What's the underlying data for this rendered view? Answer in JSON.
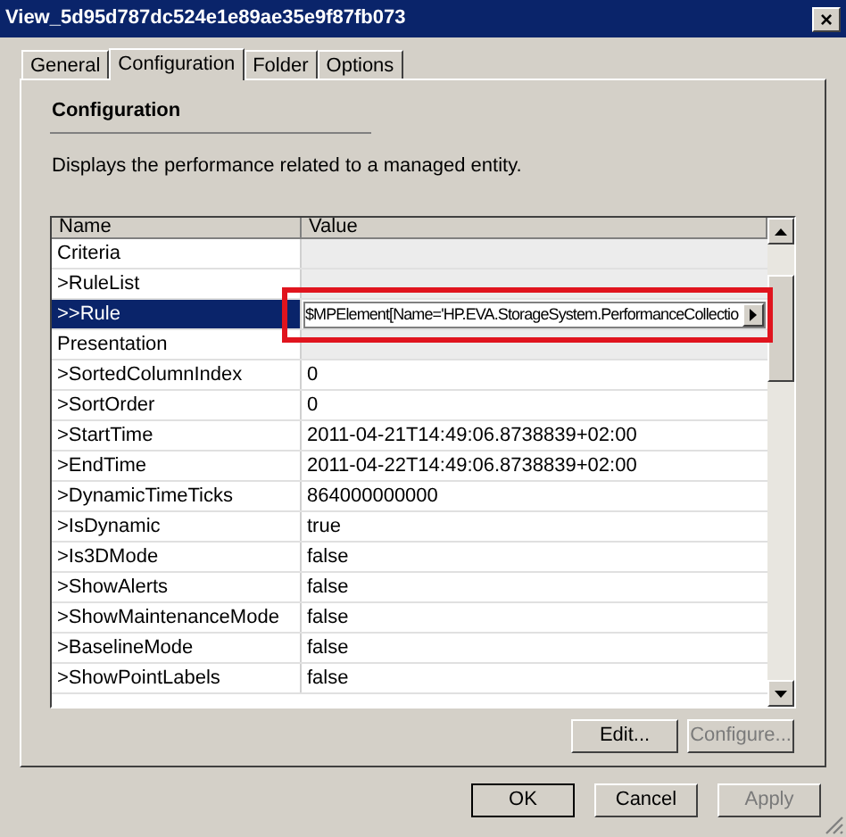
{
  "window": {
    "title": "View_5d95d787dc524e1e89ae35e9f87fb073",
    "close": "×"
  },
  "tabs": [
    {
      "label": "General",
      "selected": false
    },
    {
      "label": "Configuration",
      "selected": true
    },
    {
      "label": "Folder",
      "selected": false
    },
    {
      "label": "Options",
      "selected": false
    }
  ],
  "section": {
    "heading": "Configuration",
    "description": "Displays the performance related to a managed entity."
  },
  "grid": {
    "columns": [
      "Name",
      "Value"
    ],
    "rows": [
      {
        "name": "Criteria",
        "value": "",
        "kind": "category",
        "selected": false
      },
      {
        "name": ">RuleList",
        "value": "",
        "kind": "category",
        "selected": false
      },
      {
        "name": ">>Rule",
        "value": "$MPElement[Name='HP.EVA.StorageSystem.PerformanceCollectio",
        "kind": "editing",
        "selected": true,
        "highlighted": true
      },
      {
        "name": "Presentation",
        "value": "",
        "kind": "category",
        "selected": false
      },
      {
        "name": ">SortedColumnIndex",
        "value": "0",
        "kind": "property",
        "selected": false
      },
      {
        "name": ">SortOrder",
        "value": "0",
        "kind": "property",
        "selected": false
      },
      {
        "name": ">StartTime",
        "value": "2011-04-21T14:49:06.8738839+02:00",
        "kind": "property",
        "selected": false
      },
      {
        "name": ">EndTime",
        "value": "2011-04-22T14:49:06.8738839+02:00",
        "kind": "property",
        "selected": false
      },
      {
        "name": ">DynamicTimeTicks",
        "value": "864000000000",
        "kind": "property",
        "selected": false
      },
      {
        "name": ">IsDynamic",
        "value": "true",
        "kind": "property",
        "selected": false
      },
      {
        "name": ">Is3DMode",
        "value": "false",
        "kind": "property",
        "selected": false
      },
      {
        "name": ">ShowAlerts",
        "value": "false",
        "kind": "property",
        "selected": false
      },
      {
        "name": ">ShowMaintenanceMode",
        "value": "false",
        "kind": "property",
        "selected": false
      },
      {
        "name": ">BaselineMode",
        "value": "false",
        "kind": "property",
        "selected": false
      },
      {
        "name": ">ShowPointLabels",
        "value": "false",
        "kind": "property",
        "selected": false
      }
    ]
  },
  "panel_buttons": [
    {
      "label": "Edit...",
      "disabled": false
    },
    {
      "label": "Configure...",
      "disabled": true
    }
  ],
  "dialog_buttons": [
    {
      "label": "OK",
      "disabled": false,
      "default": true
    },
    {
      "label": "Cancel",
      "disabled": false,
      "default": false
    },
    {
      "label": "Apply",
      "disabled": true,
      "default": false
    }
  ]
}
